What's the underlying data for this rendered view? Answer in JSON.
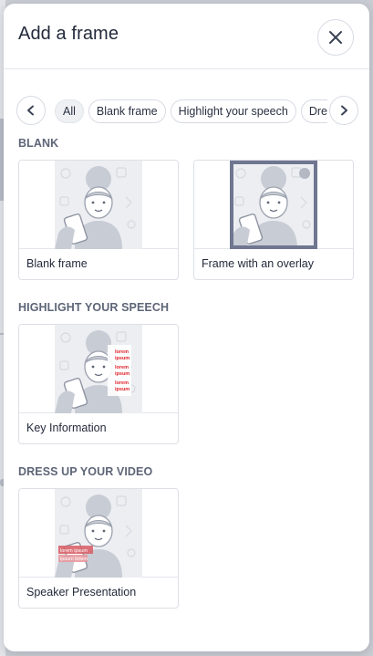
{
  "dialog": {
    "title": "Add a frame",
    "close_icon": "close-icon"
  },
  "filters": {
    "prev_icon": "chevron-left-icon",
    "next_icon": "chevron-right-icon",
    "chips": [
      {
        "label": "All",
        "active": true
      },
      {
        "label": "Blank frame",
        "active": false
      },
      {
        "label": "Highlight your speech",
        "active": false
      },
      {
        "label": "Dress up your video",
        "active": false
      }
    ]
  },
  "sections": [
    {
      "heading": "BLANK",
      "cards": [
        {
          "label": "Blank frame",
          "thumbnail": "blank-frame"
        },
        {
          "label": "Frame with an overlay",
          "thumbnail": "frame-overlay"
        }
      ]
    },
    {
      "heading": "HIGHLIGHT YOUR SPEECH",
      "cards": [
        {
          "label": "Key Information",
          "thumbnail": "key-information",
          "overlay_text": [
            "lorem",
            "ipsum",
            "lorem",
            "ipsum",
            "lorem",
            "ipsum"
          ]
        }
      ]
    },
    {
      "heading": "DRESS UP YOUR VIDEO",
      "cards": [
        {
          "label": "Speaker Presentation",
          "thumbnail": "speaker-presentation",
          "overlay_text": [
            "lorem ipsum",
            "ipsum lorem"
          ]
        }
      ]
    }
  ],
  "colors": {
    "overlay_frame": "#6f7690",
    "highlight_red": "#e0232b",
    "lower_third": "#d9636a"
  }
}
